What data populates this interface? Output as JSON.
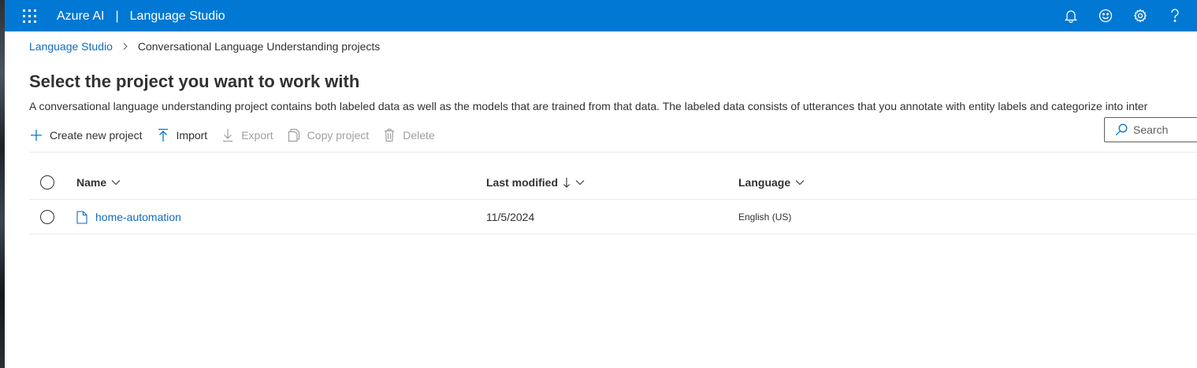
{
  "topbar": {
    "brand": "Azure AI",
    "separator": "|",
    "product": "Language Studio",
    "icons": [
      "waffle-icon",
      "bell-icon",
      "smiley-icon",
      "gear-icon",
      "help-icon"
    ]
  },
  "breadcrumb": {
    "root": "Language Studio",
    "current": "Conversational Language Understanding projects"
  },
  "page": {
    "title": "Select the project you want to work with",
    "description": "A conversational language understanding project contains both labeled data as well as the models that are trained from that data. The labeled data consists of utterances that you annotate with entity labels and categorize into inter"
  },
  "toolbar": {
    "create_label": "Create new project",
    "import_label": "Import",
    "export_label": "Export",
    "copy_label": "Copy project",
    "delete_label": "Delete"
  },
  "search": {
    "placeholder": "Search"
  },
  "table": {
    "columns": {
      "name": "Name",
      "modified": "Last modified",
      "language": "Language"
    },
    "rows": [
      {
        "name": "home-automation",
        "modified": "11/5/2024",
        "language": "English (US)"
      }
    ]
  },
  "colors": {
    "accent": "#0078d4",
    "link": "#0f6cbd",
    "text": "#323130",
    "disabled": "#a19f9d"
  }
}
